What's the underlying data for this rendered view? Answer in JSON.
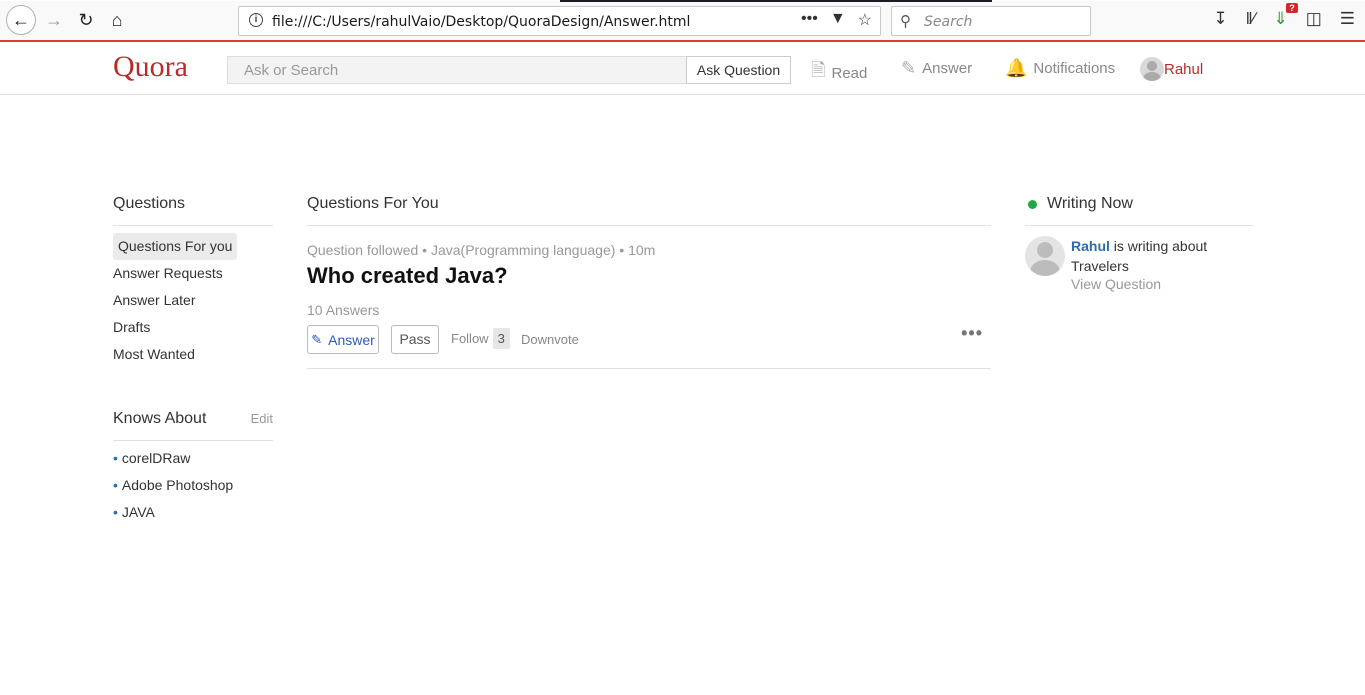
{
  "browser": {
    "url": "file:///C:/Users/rahulVaio/Desktop/QuoraDesign/Answer.html",
    "search_placeholder": "Search",
    "download_badge": "?"
  },
  "header": {
    "logo": "Quora",
    "search_placeholder": "Ask or Search",
    "ask_button": "Ask Question",
    "nav": [
      {
        "label": "Read",
        "icon": "document-icon"
      },
      {
        "label": "Answer",
        "icon": "pencil-icon"
      },
      {
        "label": "Notifications",
        "icon": "bell-icon"
      }
    ],
    "profile_name": "Rahul"
  },
  "sidebar": {
    "title": "Questions",
    "items": [
      "Questions For you",
      "Answer Requests",
      "Answer Later",
      "Drafts",
      "Most Wanted"
    ],
    "knows_title": "Knows About",
    "edit_label": "Edit",
    "topics": [
      "corelDRaw",
      "Adobe Photoshop",
      "JAVA"
    ]
  },
  "main": {
    "title": "Questions For You",
    "meta": "Question followed • Java(Programming language) • 10m",
    "question": "Who created Java?",
    "answer_count": "10 Answers",
    "answer_btn": "Answer",
    "pass_btn": "Pass",
    "follow_label": "Follow",
    "follow_count": "3",
    "downvote_label": "Downvote"
  },
  "right": {
    "title": "Writing Now",
    "writer_name": "Rahul",
    "writing_text": " is writing about Travelers",
    "view_question": "View Question"
  }
}
